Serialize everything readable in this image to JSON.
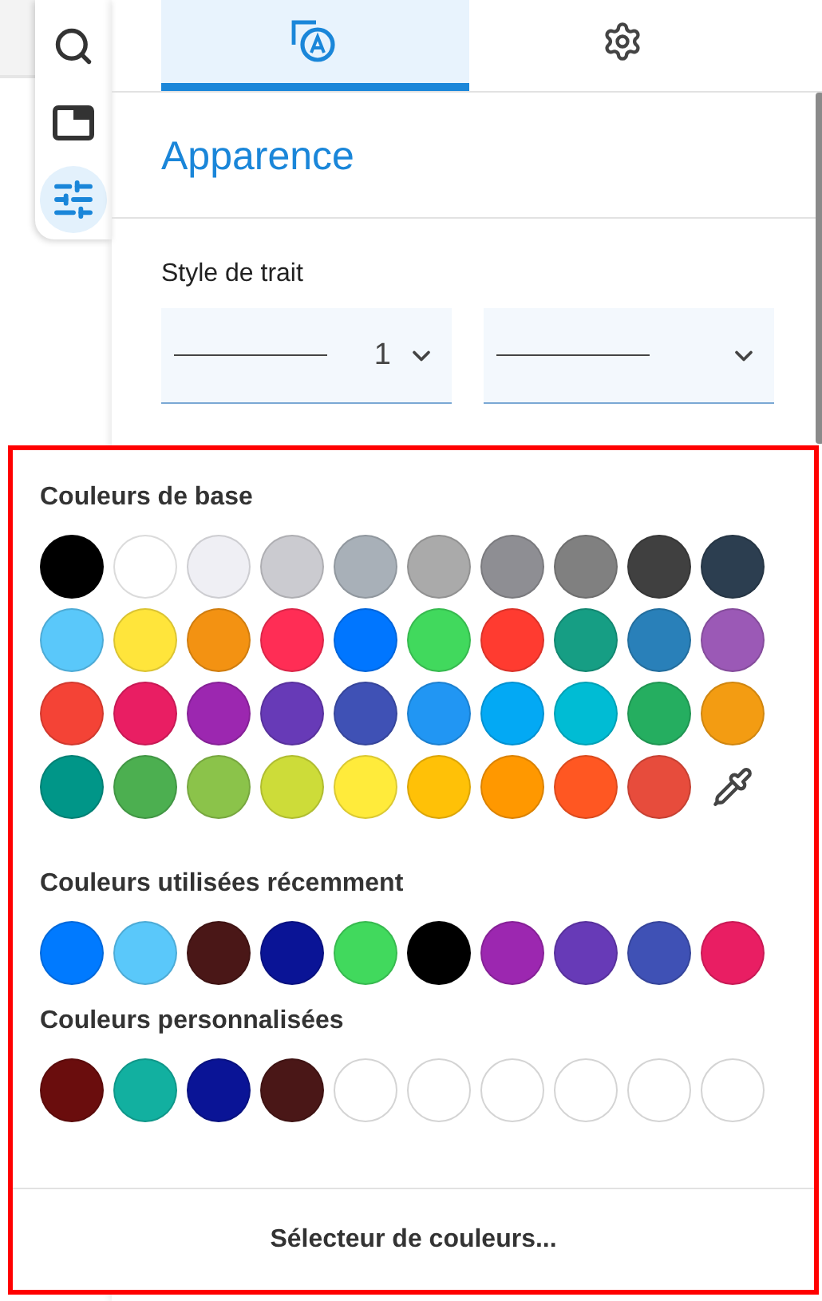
{
  "side_toolbar": [
    {
      "kind": "search",
      "selected": false
    },
    {
      "kind": "panel",
      "selected": false
    },
    {
      "kind": "sliders",
      "selected": true
    }
  ],
  "tabs": [
    {
      "kind": "appearance",
      "selected": true
    },
    {
      "kind": "settings",
      "selected": false
    }
  ],
  "section_title": "Apparence",
  "stroke_style": {
    "label": "Style de trait",
    "dropdowns": [
      {
        "kind": "width",
        "value": "1"
      },
      {
        "kind": "dash"
      }
    ]
  },
  "color_popup": {
    "base": {
      "title": "Couleurs de base",
      "swatches": [
        {
          "kind": "color",
          "color": "#000000"
        },
        {
          "kind": "color",
          "color": "#ffffff"
        },
        {
          "kind": "color",
          "color": "#efeff4"
        },
        {
          "kind": "color",
          "color": "#cbcbd0"
        },
        {
          "kind": "color",
          "color": "#a8b0b8"
        },
        {
          "kind": "color",
          "color": "#aaaaaa"
        },
        {
          "kind": "color",
          "color": "#8e8e93"
        },
        {
          "kind": "color",
          "color": "#808080"
        },
        {
          "kind": "color",
          "color": "#404040"
        },
        {
          "kind": "color",
          "color": "#2c3e50"
        },
        {
          "kind": "color",
          "color": "#5ac8fa"
        },
        {
          "kind": "color",
          "color": "#ffe53b"
        },
        {
          "kind": "color",
          "color": "#f39212"
        },
        {
          "kind": "color",
          "color": "#ff2d55"
        },
        {
          "kind": "color",
          "color": "#0076ff"
        },
        {
          "kind": "color",
          "color": "#41d95d"
        },
        {
          "kind": "color",
          "color": "#ff3b30"
        },
        {
          "kind": "color",
          "color": "#169e84"
        },
        {
          "kind": "color",
          "color": "#2980b9"
        },
        {
          "kind": "color",
          "color": "#9b59b6"
        },
        {
          "kind": "color",
          "color": "#f44336"
        },
        {
          "kind": "color",
          "color": "#e91e63"
        },
        {
          "kind": "color",
          "color": "#9c27b0"
        },
        {
          "kind": "color",
          "color": "#673ab7"
        },
        {
          "kind": "color",
          "color": "#3f51b5"
        },
        {
          "kind": "color",
          "color": "#2196f3"
        },
        {
          "kind": "color",
          "color": "#03a9f4"
        },
        {
          "kind": "color",
          "color": "#00bcd4"
        },
        {
          "kind": "color",
          "color": "#25ae60"
        },
        {
          "kind": "color",
          "color": "#f39c12"
        },
        {
          "kind": "color",
          "color": "#009688"
        },
        {
          "kind": "color",
          "color": "#4caf50"
        },
        {
          "kind": "color",
          "color": "#8bc34a"
        },
        {
          "kind": "color",
          "color": "#cddc39"
        },
        {
          "kind": "color",
          "color": "#ffeb3b"
        },
        {
          "kind": "color",
          "color": "#ffc107"
        },
        {
          "kind": "color",
          "color": "#ff9800"
        },
        {
          "kind": "color",
          "color": "#ff5722"
        },
        {
          "kind": "color",
          "color": "#e74c3c"
        },
        {
          "kind": "eyedropper"
        }
      ]
    },
    "recent": {
      "title": "Couleurs utilisées récemment",
      "swatches": [
        {
          "kind": "color",
          "color": "#007aff"
        },
        {
          "kind": "color",
          "color": "#5ac8fa"
        },
        {
          "kind": "color",
          "color": "#4a1717"
        },
        {
          "kind": "color",
          "color": "#0a1496"
        },
        {
          "kind": "color",
          "color": "#41d95d"
        },
        {
          "kind": "color",
          "color": "#000000"
        },
        {
          "kind": "color",
          "color": "#9c27b0"
        },
        {
          "kind": "color",
          "color": "#673ab7"
        },
        {
          "kind": "color",
          "color": "#3f51b5"
        },
        {
          "kind": "color",
          "color": "#e91e63"
        }
      ]
    },
    "custom": {
      "title": "Couleurs personnalisées",
      "swatches": [
        {
          "kind": "color",
          "color": "#6a0d0d"
        },
        {
          "kind": "color",
          "color": "#12b0a0"
        },
        {
          "kind": "color",
          "color": "#0a1496"
        },
        {
          "kind": "color",
          "color": "#4a1717"
        },
        {
          "kind": "empty"
        },
        {
          "kind": "empty"
        },
        {
          "kind": "empty"
        },
        {
          "kind": "empty"
        },
        {
          "kind": "empty"
        },
        {
          "kind": "empty"
        }
      ]
    },
    "picker_button": "Sélecteur de couleurs..."
  }
}
